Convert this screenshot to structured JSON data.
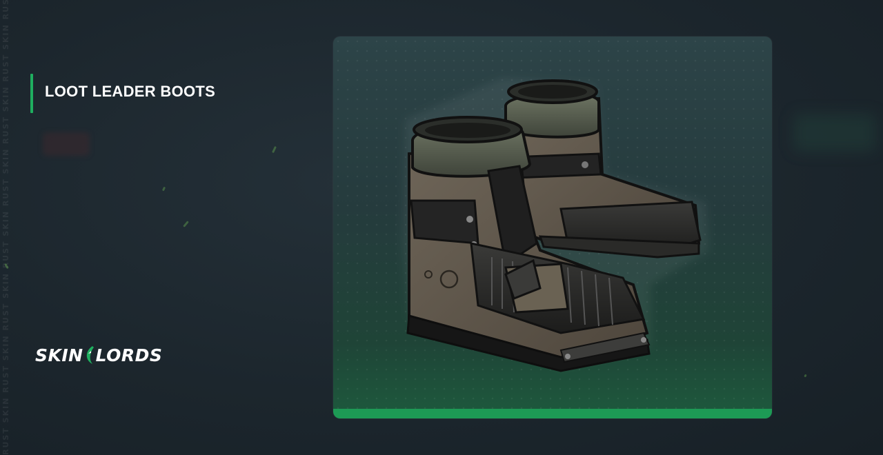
{
  "item": {
    "title": "LOOT LEADER BOOTS"
  },
  "brand": {
    "logo_left": "SKIN",
    "logo_right": "LORDS",
    "logo_icon": "dragon-claw-icon",
    "accent_color": "#1fae5f"
  },
  "watermark": {
    "text": "RUST SKIN RUST SKIN RUST SKIN RUST SKIN RUST SKIN RUST SKIN RUST SKIN RUST SKIN"
  },
  "card": {
    "image_icon": "boots-icon",
    "bar_color": "#1d9a55"
  }
}
